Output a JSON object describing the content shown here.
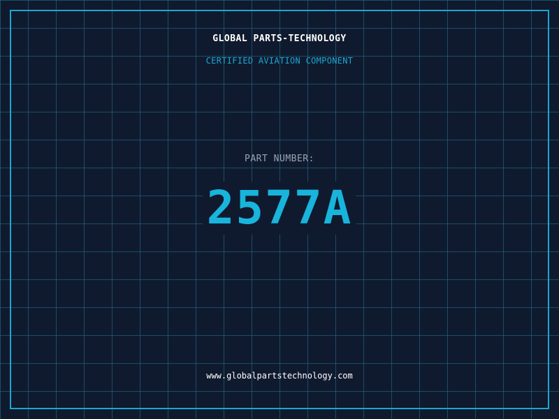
{
  "header": {
    "brand": "GLOBAL PARTS-TECHNOLOGY",
    "tagline": "CERTIFIED AVIATION COMPONENT"
  },
  "part": {
    "label": "PART NUMBER:",
    "number": "2577A"
  },
  "footer": {
    "website": "www.globalpartstechnology.com"
  },
  "colors": {
    "background": "#101a2e",
    "grid": "#1e7896",
    "accent": "#1aa8d0",
    "part_number": "#18b4dc",
    "label": "#9aa4b4",
    "text": "#ffffff"
  }
}
